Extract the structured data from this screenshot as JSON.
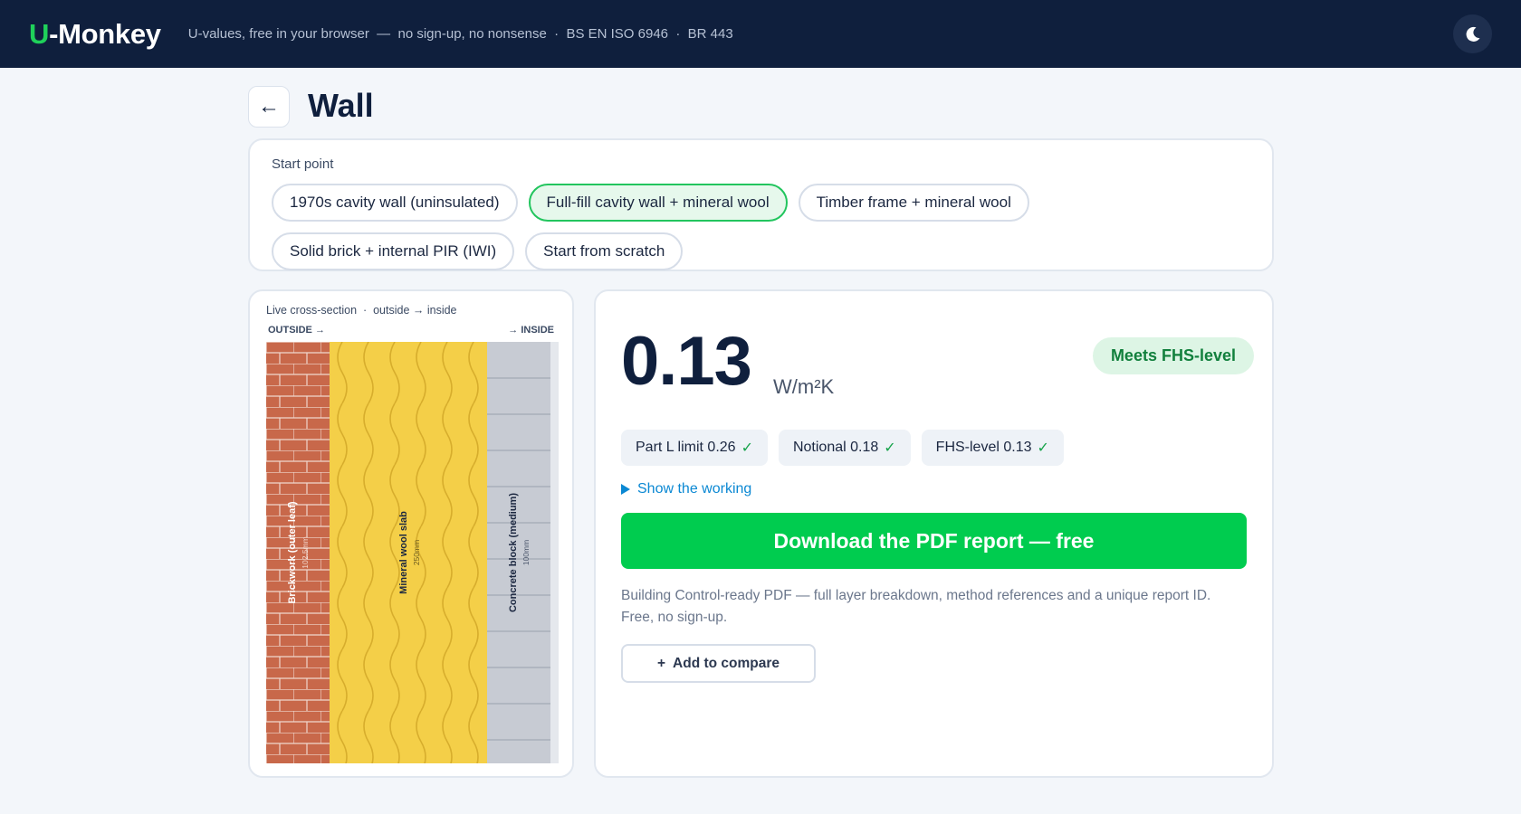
{
  "header": {
    "logo_u": "U",
    "logo_rest": "-Monkey",
    "tagline": "U-values, free in your browser  —  no sign-up, no nonsense  ·  BS EN ISO 6946  ·  BR 443",
    "theme_icon": "moon-icon"
  },
  "page": {
    "back_label": "←",
    "title": "Wall"
  },
  "start_point": {
    "label": "Start point",
    "options": [
      {
        "label": "1970s cavity wall (uninsulated)",
        "selected": false
      },
      {
        "label": "Full-fill cavity wall + mineral wool",
        "selected": true
      },
      {
        "label": "Timber frame + mineral wool",
        "selected": false
      },
      {
        "label": "Solid brick + internal PIR (IWI)",
        "selected": false
      },
      {
        "label": "Start from scratch",
        "selected": false
      }
    ]
  },
  "cross_section": {
    "caption": "Live cross-section  ·  outside → inside",
    "outside_label": "OUTSIDE →",
    "inside_label": "→ INSIDE",
    "layers": [
      {
        "name": "Brickwork (outer leaf)",
        "thickness": "102.5mm",
        "color": "#c8684a"
      },
      {
        "name": "Mineral wool slab",
        "thickness": "250mm",
        "color": "#f4cf48"
      },
      {
        "name": "Concrete block (medium)",
        "thickness": "100mm",
        "color": "#c7cbd3"
      }
    ]
  },
  "result": {
    "value": "0.13",
    "unit": "W/m²K",
    "status_badge": "Meets FHS-level",
    "limits": [
      {
        "label": "Part L limit 0.26",
        "tick": "✓"
      },
      {
        "label": "Notional 0.18",
        "tick": "✓"
      },
      {
        "label": "FHS-level 0.13",
        "tick": "✓"
      }
    ],
    "show_working": "Show the working",
    "pdf_button": "Download the PDF report — free",
    "pdf_note": "Building Control-ready PDF — full layer breakdown, method references and a unique report ID. Free, no sign-up.",
    "compare_plus": "+",
    "compare_button": "Add to compare"
  },
  "colors": {
    "navy": "#0f1f3d",
    "accent_green": "#00cc4f",
    "link_blue": "#0b88d3"
  }
}
